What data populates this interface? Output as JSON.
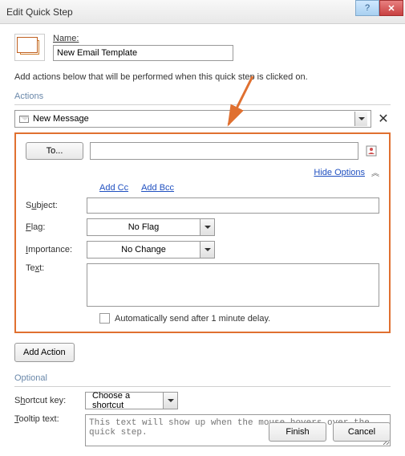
{
  "title": "Edit Quick Step",
  "name": {
    "label": "Name:",
    "value": "New Email Template"
  },
  "instruction": "Add actions below that will be performed when this quick step is clicked on.",
  "sections": {
    "actions": "Actions",
    "optional": "Optional"
  },
  "action_select": {
    "value": "New Message"
  },
  "to": {
    "button": "To...",
    "value": ""
  },
  "hide_options": "Hide Options",
  "links": {
    "add_cc": "Add Cc",
    "add_bcc": "Add Bcc"
  },
  "fields": {
    "subject": {
      "label": "Subject:",
      "value": ""
    },
    "flag": {
      "label": "Flag:",
      "value": "No Flag"
    },
    "importance": {
      "label": "Importance:",
      "value": "No Change"
    },
    "text": {
      "label": "Text:",
      "value": ""
    }
  },
  "auto_send": {
    "checked": false,
    "label": "Automatically send after 1 minute delay."
  },
  "add_action": "Add Action",
  "shortcut": {
    "label": "Shortcut key:",
    "value": "Choose a shortcut"
  },
  "tooltip": {
    "label": "Tooltip text:",
    "placeholder": "This text will show up when the mouse hovers over the quick step."
  },
  "buttons": {
    "finish": "Finish",
    "cancel": "Cancel"
  },
  "colors": {
    "highlight": "#e07030"
  }
}
